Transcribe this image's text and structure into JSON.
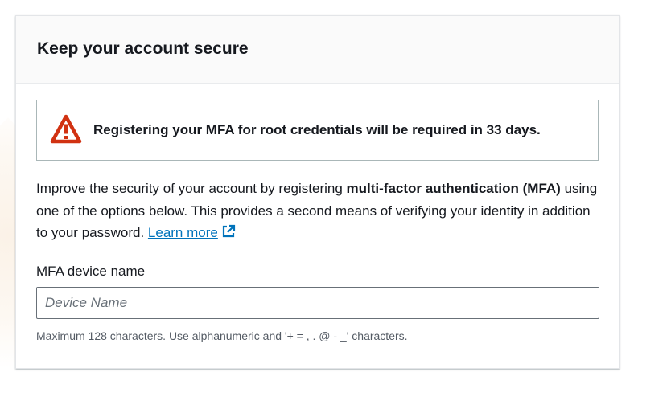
{
  "card": {
    "title": "Keep your account secure"
  },
  "alert": {
    "icon": "warning-triangle-icon",
    "color": "#d13212",
    "message": "Registering your MFA for root credentials will be required in 33 days."
  },
  "description": {
    "part1": "Improve the security of your account by registering ",
    "bold": "multi-factor authentication (MFA)",
    "part2": " using one of the options below. This provides a second means of verifying your identity in addition to your password. ",
    "link_label": "Learn more",
    "link_icon": "external-link-icon",
    "link_color": "#0073bb"
  },
  "mfa_field": {
    "label": "MFA device name",
    "placeholder": "Device Name",
    "value": "",
    "hint": "Maximum 128 characters. Use alphanumeric and '+ = , . @ - _' characters."
  }
}
